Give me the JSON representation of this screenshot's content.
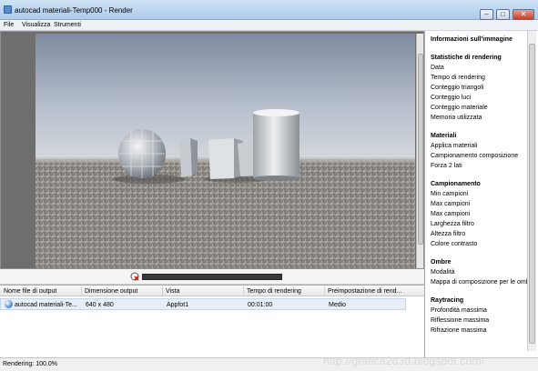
{
  "window": {
    "title": "autocad materiali-Temp000 - Render"
  },
  "menu": [
    "File",
    "Visualizza",
    "Strumenti"
  ],
  "table": {
    "headers": [
      "Nome file di output",
      "Dimensione output",
      "Vista",
      "Tempo di rendering",
      "Preimpostazione di rend..."
    ],
    "row": [
      "autocad materiali-Te...",
      "640 x 480",
      "Appfot1",
      "00:01:00",
      "Medio"
    ]
  },
  "render_progress": 1.0,
  "status": "Rendering: 100.0%",
  "watermark": "http://grafica2d3d.blogspot.com/",
  "panel": {
    "title": "Informazioni sull'immagine",
    "sections": [
      {
        "header": "Statistiche di rendering",
        "items": [
          "Data",
          "Tempo di rendering",
          "Conteggio triangoli",
          "Conteggio luci",
          "Conteggio materiale",
          "Memoria utilizzata"
        ]
      },
      {
        "header": "Materiali",
        "items": [
          "Applica materiali",
          "Campionamento composizione",
          "Forza 2 lati"
        ]
      },
      {
        "header": "Campionamento",
        "items": [
          "Min campioni",
          "Max campioni",
          "Max campioni",
          "Larghezza filtro",
          "Altezza filtro",
          "Colore contrasto"
        ]
      },
      {
        "header": "Ombre",
        "items": [
          "Modalità",
          "Mappa di composizione per le ombre"
        ]
      },
      {
        "header": "Raytracing",
        "items": [
          "Profondità massima",
          "Riflessione massima",
          "Rifrazione massima"
        ]
      }
    ]
  }
}
